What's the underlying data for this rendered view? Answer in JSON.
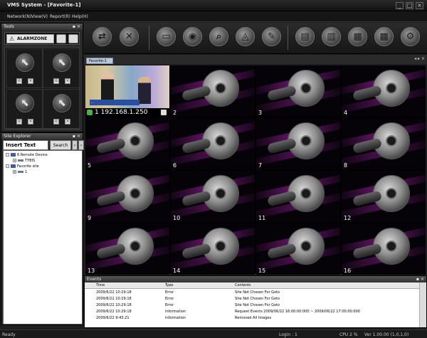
{
  "window": {
    "title": "VMS System - [Favorite-1]",
    "min": "_",
    "max": "□",
    "close": "×"
  },
  "menu": [
    "Network(N)",
    "View(V)",
    "Report(R)",
    "Help(H)"
  ],
  "tools": {
    "title": "Tools",
    "alarm_label": "ALARMZONE"
  },
  "toolbar": {
    "icons": [
      "connect-icon",
      "disconnect-icon",
      "folder-icon",
      "reel-icon",
      "search-icon",
      "map-icon",
      "wrench-icon",
      "recorder-icon",
      "print-icon",
      "grid-icon",
      "settings-icon"
    ]
  },
  "explorer": {
    "title": "Site Explorer",
    "tab_active": "Insert Text",
    "tab_search": "Search",
    "tree": [
      {
        "label": "6 Remote Device",
        "level": 0
      },
      {
        "label": "TYBIS",
        "level": 1
      },
      {
        "label": "Favorite site",
        "level": 0
      },
      {
        "label": "1",
        "level": 1
      }
    ]
  },
  "favorite": {
    "tab": "Favorite-1",
    "controls": "◂ ▸ ×"
  },
  "cameras": {
    "first_ip": "1 192.168.1.250",
    "first_subtitle": "...",
    "numbers": [
      "2",
      "3",
      "4",
      "5",
      "6",
      "7",
      "8",
      "9",
      "10",
      "11",
      "12",
      "13",
      "14",
      "15",
      "16"
    ]
  },
  "events": {
    "title": "Events",
    "columns": [
      "Time",
      "Type",
      "Contents"
    ],
    "rows": [
      [
        "2009/6/22 10:29:18",
        "Error",
        "Site Not Chosen For Goto"
      ],
      [
        "2009/6/22 10:29:18",
        "Error",
        "Site Not Chosen For Goto"
      ],
      [
        "2009/6/22 10:29:18",
        "Error",
        "Site Not Chosen For Goto"
      ],
      [
        "2009/6/22 10:29:18",
        "Information",
        "Request Events 2009/06/22 16:00:00:000 ~ 2009/06/22 17:00:00:000"
      ],
      [
        "2009/6/22 9:43:21",
        "Information",
        "Removed All Images"
      ]
    ]
  },
  "status": {
    "ready": "Ready",
    "login": "Login : 1",
    "cpu": "CPU 2 %",
    "version": "Ver 1.00.00 (1,0,1,0)"
  }
}
